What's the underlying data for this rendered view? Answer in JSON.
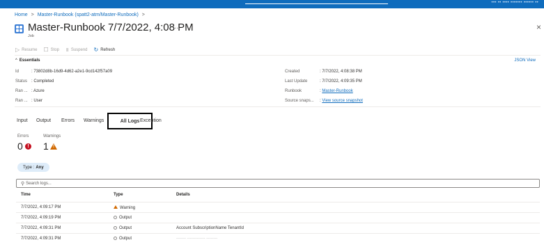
{
  "colors": {
    "accent": "#0f6cbd",
    "error": "#c50f1f",
    "warning": "#d16900"
  },
  "topbar": {
    "right_text": "••• •• •••• ••••••• •••••• ••"
  },
  "breadcrumb": {
    "items": [
      "Home",
      "Master-Runbook (spatt2-atm/Master-Runbook)"
    ],
    "separator": ">"
  },
  "header": {
    "title": "Master-Runbook 7/7/2022, 4:08 PM",
    "subtitle": "Job",
    "more": "...",
    "close": "×"
  },
  "toolbar": {
    "resume": "Resume",
    "stop": "Stop",
    "suspend": "Suspend",
    "refresh": "Refresh"
  },
  "essentials": {
    "heading": "Essentials",
    "json_view": "JSON View",
    "left": [
      {
        "key": "Id",
        "value": ": 73802d8b-16d9-4d62-a2e1-9cd142f57a09"
      },
      {
        "key": "Status",
        "value": ": Completed"
      },
      {
        "key": "Ran ...",
        "value": ": Azure"
      },
      {
        "key": "Ran ...",
        "value": ": User"
      }
    ],
    "right": [
      {
        "key": "Created",
        "value": ": 7/7/2022, 4:08:38 PM"
      },
      {
        "key": "Last Update",
        "value": ": 7/7/2022, 4:09:35 PM"
      },
      {
        "key": "Runbook",
        "sep": ": ",
        "value": "Master-Runbook"
      },
      {
        "key": "Source snaps...",
        "sep": ": ",
        "value": "View source snapshot"
      }
    ]
  },
  "tabs": [
    "Input",
    "Output",
    "Errors",
    "Warnings",
    "All Logs",
    "Exception"
  ],
  "selected_tab": "All Logs",
  "counts": {
    "errors_label": "Errors",
    "errors_value": "0",
    "warnings_label": "Warnings",
    "warnings_value": "1"
  },
  "filter": {
    "label": "Type :",
    "value": "Any"
  },
  "search": {
    "placeholder": "Search logs..."
  },
  "table": {
    "headers": [
      "Time",
      "Type",
      "Details"
    ],
    "rows": [
      {
        "time": "7/7/2022, 4:09:17 PM",
        "type": "Warning",
        "details": ""
      },
      {
        "time": "7/7/2022, 4:09:19 PM",
        "type": "Output",
        "details": ""
      },
      {
        "time": "7/7/2022, 4:09:31 PM",
        "type": "Output",
        "details": "Account SubscriptionName TenantId"
      },
      {
        "time": "7/7/2022, 4:09:31 PM",
        "type": "Output",
        "details": "------- ------------- --------"
      }
    ]
  }
}
